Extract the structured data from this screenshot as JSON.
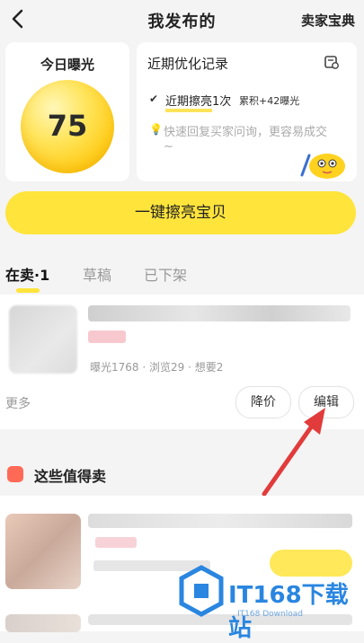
{
  "header": {
    "title": "我发布的",
    "right_link": "卖家宝典"
  },
  "exposure": {
    "label": "今日曝光",
    "value": "75"
  },
  "optimization": {
    "title": "近期优化记录",
    "record_highlight": "近期擦亮",
    "record_count": "1次",
    "record_extra": "累积+42曝光",
    "tip_line1": "快速回复买家问询，更容易成交",
    "tip_line2": "~"
  },
  "polish_button": "一键擦亮宝贝",
  "tabs": {
    "active": "在卖",
    "active_sep": "·",
    "active_count": "1",
    "draft": "草稿",
    "off": "已下架"
  },
  "listing": {
    "stats": "曝光1768 · 浏览29 · 想要2",
    "more": "更多",
    "price_button": "降价",
    "edit_button": "编辑"
  },
  "worth_selling": {
    "title": "这些值得卖"
  },
  "watermark": {
    "brand": "IT168下载站",
    "sub": "IT168 Download"
  },
  "colors": {
    "accent_yellow": "#ffe43c",
    "arrow_red": "#e23b3b",
    "watermark_blue": "#2a86e0"
  }
}
